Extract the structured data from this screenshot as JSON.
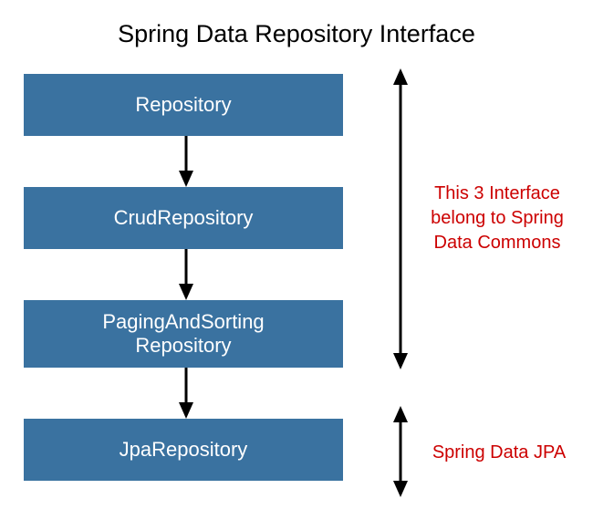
{
  "title": "Spring Data Repository Interface",
  "boxes": [
    {
      "label": "Repository"
    },
    {
      "label": "CrudRepository"
    },
    {
      "label": "PagingAndSorting\nRepository"
    },
    {
      "label": "JpaRepository"
    }
  ],
  "annotations": {
    "commons": "This 3 Interface\nbelong to Spring\nData Commons",
    "jpa": "Spring Data JPA"
  },
  "colors": {
    "box_bg": "#3a72a0",
    "box_text": "#ffffff",
    "annotation_text": "#cc0000"
  }
}
